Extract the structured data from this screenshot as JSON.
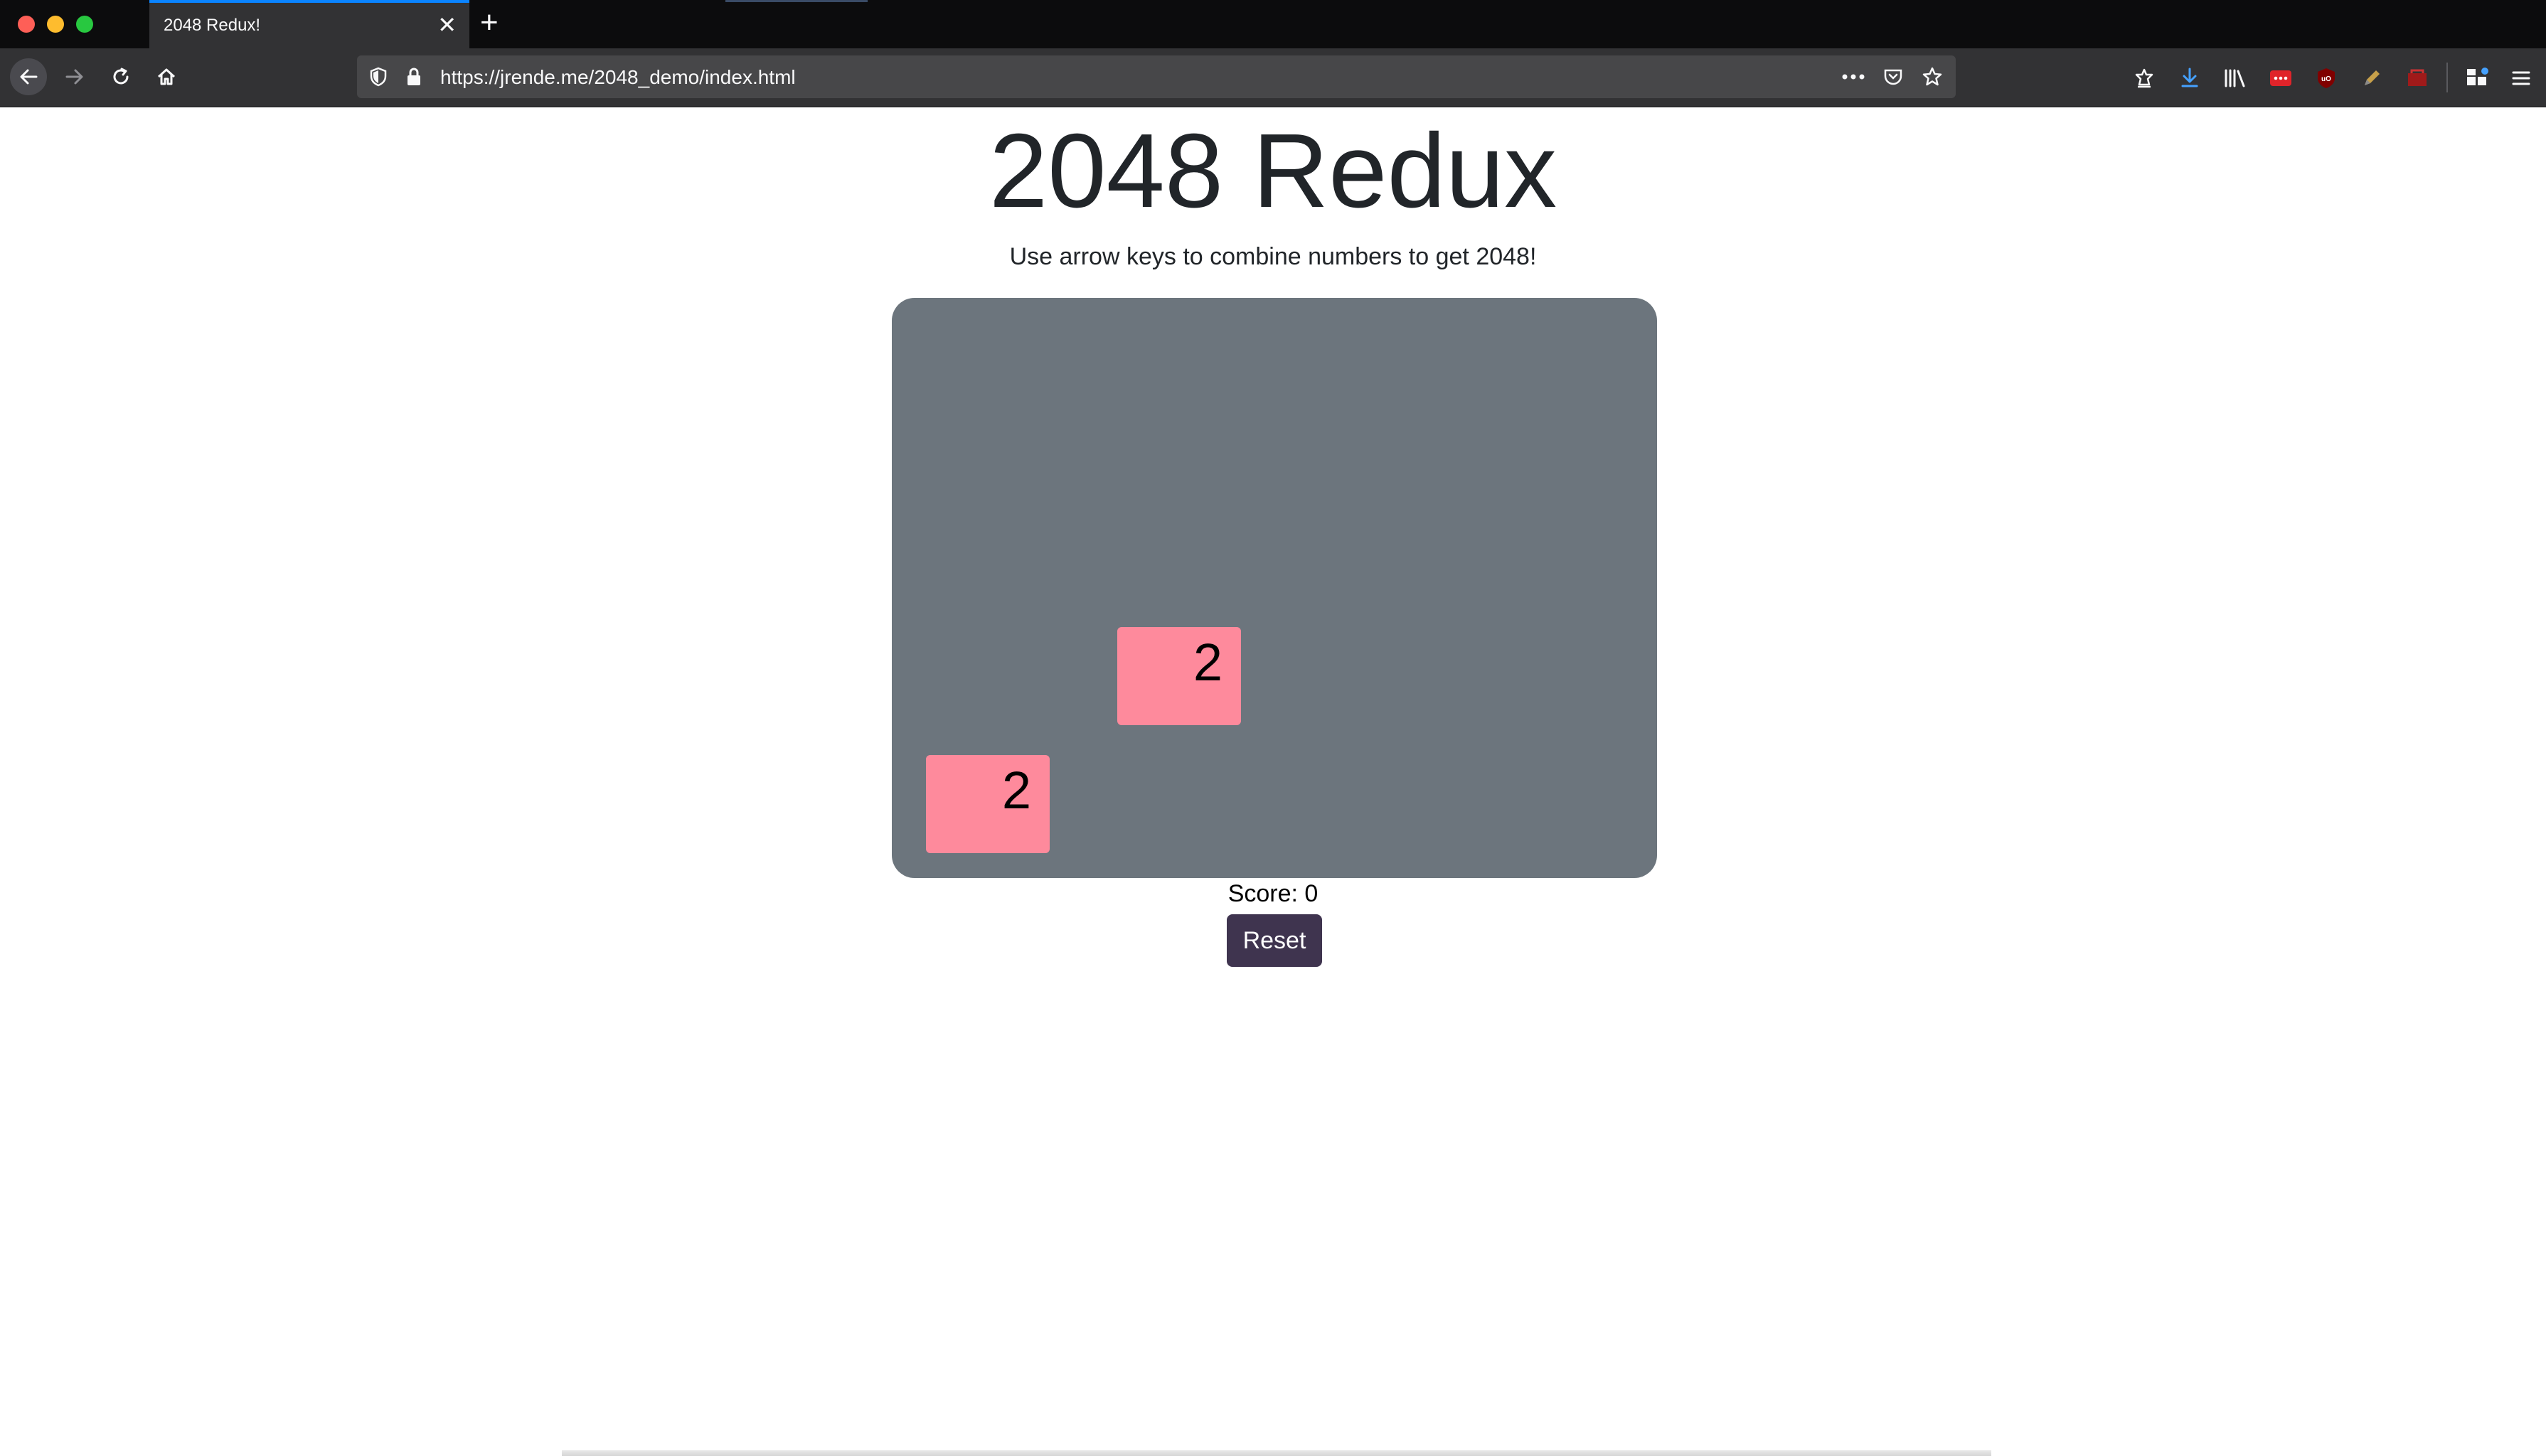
{
  "browser": {
    "tab_title": "2048 Redux!",
    "url": "https://jrende.me/2048_demo/index.html",
    "icons": [
      "back-icon",
      "forward-icon",
      "reload-icon",
      "home-icon",
      "shield-icon",
      "lock-icon",
      "more-icon",
      "pocket-icon",
      "star-icon",
      "sync-icon",
      "download-icon",
      "library-icon",
      "extension-icon",
      "ublock-icon",
      "pen-icon",
      "extension-red-icon",
      "extensions-icon",
      "menu-icon"
    ]
  },
  "page": {
    "title": "2048 Redux",
    "subtitle": "Use arrow keys to combine numbers to get 2048!",
    "score_label": "Score: 0",
    "reset_label": "Reset"
  },
  "board": {
    "grid_size": 4,
    "tiles": [
      {
        "row": 2,
        "col": 1,
        "value": "2"
      },
      {
        "row": 3,
        "col": 0,
        "value": "2"
      }
    ]
  },
  "colors": {
    "board": "#6c757d",
    "tile": "#fe8a9c",
    "reset_button": "#3f344f",
    "tab_accent": "#0a84ff"
  }
}
